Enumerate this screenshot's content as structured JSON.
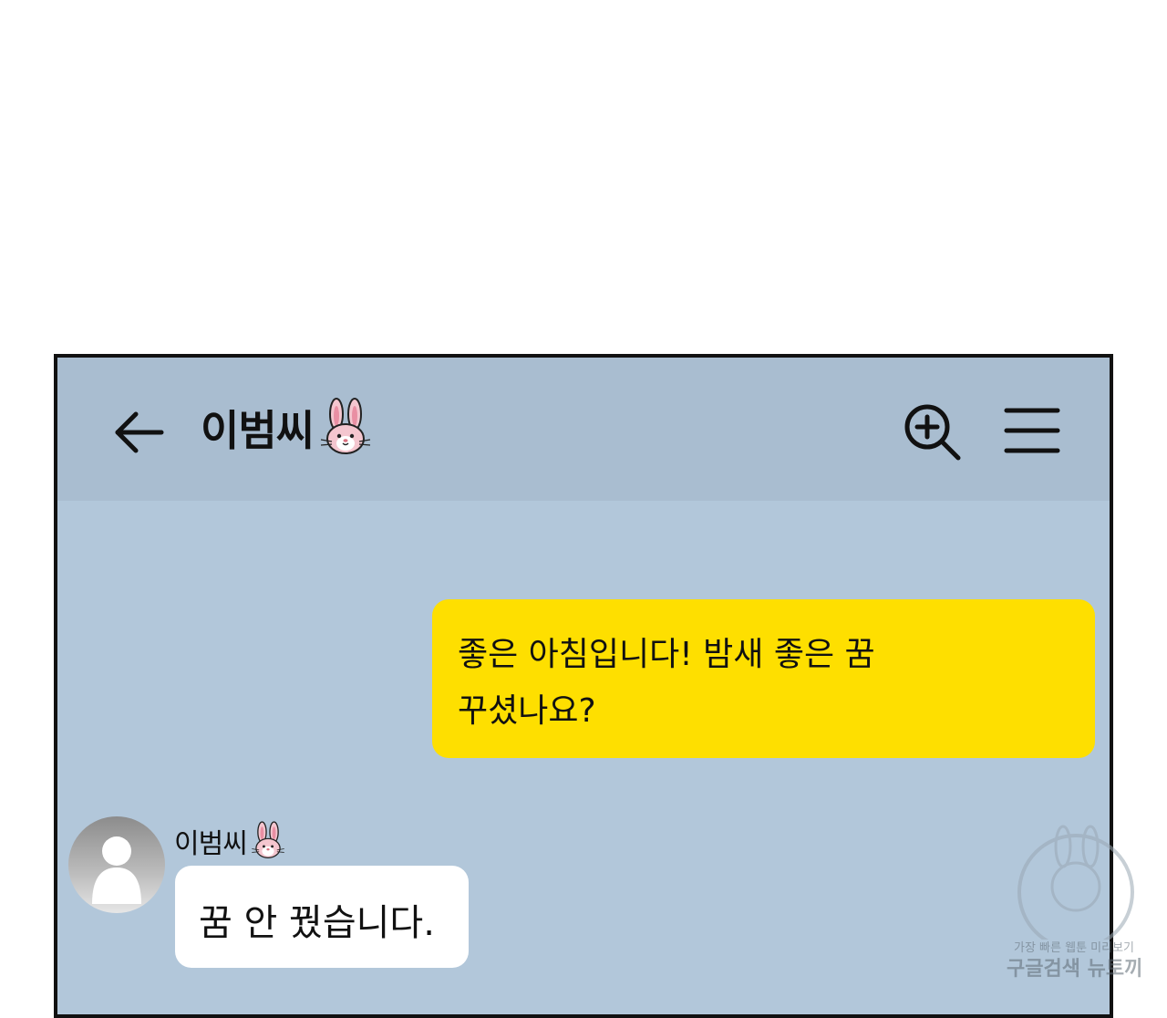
{
  "header": {
    "title": "이범씨",
    "back_icon": "arrow-left-icon",
    "title_emoji": "rabbit-face-icon",
    "search_icon": "zoom-in-icon",
    "menu_icon": "hamburger-menu-icon"
  },
  "messages": [
    {
      "direction": "outgoing",
      "lines": [
        "좋은 아침입니다! 밤새 좋은 꿈",
        "꾸셨나요?"
      ]
    },
    {
      "direction": "incoming",
      "sender": "이범씨",
      "text": "꿈 안 꿨습니다."
    }
  ],
  "watermark": {
    "line1": "가장 빠른 웹툰 미리보기",
    "line2": "구글검색 뉴토끼"
  },
  "colors": {
    "header_bg": "#a9bdd0",
    "chat_bg": "#b2c7da",
    "outgoing_bubble": "#fedf00",
    "incoming_bubble": "#ffffff"
  }
}
